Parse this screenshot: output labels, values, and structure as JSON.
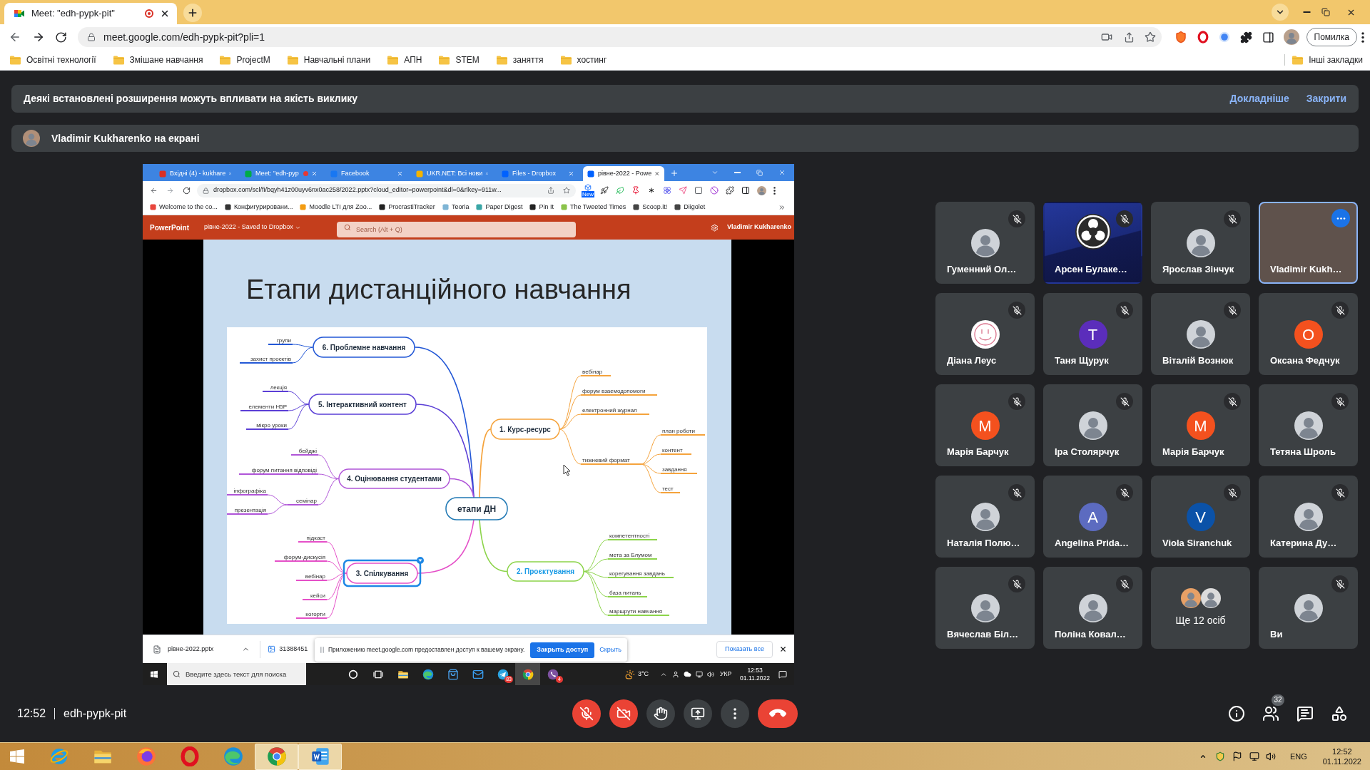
{
  "browser": {
    "tabs": [
      {
        "title": "Meet: \"edh-pypk-pit\"",
        "selected": true,
        "recording": true
      }
    ],
    "url": "meet.google.com/edh-pypk-pit?pli=1",
    "profile_status": "Помилка",
    "bookmarks": [
      "Освітні технології",
      "Змішане навчання",
      "ProjectM",
      "Навчальні плани",
      "АПН",
      "STEM",
      "заняття",
      "хостинг"
    ],
    "other_bookmarks": "Інші закладки"
  },
  "notice": {
    "text": "Деякі встановлені розширення можуть впливати на якість виклику",
    "links": [
      "Докладніше",
      "Закрити"
    ]
  },
  "presenter": {
    "text": "Vladimir Kukharenko на екрані"
  },
  "shared_screen": {
    "tabs": [
      {
        "title": "Вхідні (4) - kukhare",
        "selected": false,
        "recording": false
      },
      {
        "title": "Meet: \"edh-pyp",
        "selected": false,
        "recording": true
      },
      {
        "title": "Facebook",
        "selected": false,
        "recording": false
      },
      {
        "title": "UKR.NET: Всі нови",
        "selected": false,
        "recording": false
      },
      {
        "title": "Files - Dropbox",
        "selected": false,
        "recording": false
      },
      {
        "title": "рівне-2022 - Powe",
        "selected": true,
        "recording": false
      }
    ],
    "url": "dropbox.com/scl/fi/bqyh41z00uyv6nx0ac258/2022.pptx?cloud_editor=powerpoint&dl=0&rlkey=911w...",
    "extension_badge": "New",
    "bookmarks": [
      "Welcome to the co...",
      "Конфигурировани...",
      "Moodle LTI для Zoo...",
      "ProcrastiTracker",
      "Teoria",
      "Paper Digest",
      "Pin It",
      "The Tweeted Times",
      "Scoop.it!",
      "Diigolet"
    ],
    "app": {
      "name": "PowerPoint",
      "document": "рівне-2022 - Saved to Dropbox",
      "search_placeholder": "Search (Alt + Q)",
      "user": "Vladimir Kukharenko"
    },
    "slide": {
      "title": "Етапи дистанційного навчання",
      "mindmap": {
        "center": "етапи ДН",
        "branches": [
          {
            "label": "6. Проблемне навчання",
            "color": "#2358d6",
            "selected": false,
            "highlighted": false,
            "children": [
              {
                "label": "групи"
              },
              {
                "label": "захист проєктів"
              }
            ]
          },
          {
            "label": "5. Інтерактивний контент",
            "color": "#5b3fd6",
            "selected": false,
            "highlighted": false,
            "children": [
              {
                "label": "лекція"
              },
              {
                "label": "елементи H5P"
              },
              {
                "label": "мікро уроки"
              }
            ]
          },
          {
            "label": "1. Курс-ресурс",
            "color": "#f5a33c",
            "selected": false,
            "highlighted": false,
            "children": [
              {
                "label": "вебінар"
              },
              {
                "label": "форум взаємодопомоги"
              },
              {
                "label": "електронний журнал"
              },
              {
                "label": "тижневий формат",
                "children": [
                  {
                    "label": "план роботи"
                  },
                  {
                    "label": "контент"
                  },
                  {
                    "label": "завдання"
                  },
                  {
                    "label": "тест"
                  }
                ]
              }
            ]
          },
          {
            "label": "4. Оцінювання студентами",
            "color": "#b055d8",
            "selected": false,
            "highlighted": false,
            "children": [
              {
                "label": "бейджі"
              },
              {
                "label": "форум питання відповіді"
              },
              {
                "label": "семінар",
                "children": [
                  {
                    "label": "інфографіка"
                  },
                  {
                    "label": "презентація"
                  }
                ]
              }
            ]
          },
          {
            "label": "3. Спілкування",
            "color": "#e550c8",
            "selected": true,
            "highlighted": false,
            "children": [
              {
                "label": "підкаст"
              },
              {
                "label": "форум-дискусія"
              },
              {
                "label": "вебінар"
              },
              {
                "label": "кейси"
              },
              {
                "label": "когорти"
              }
            ]
          },
          {
            "label": "2. Проєктування",
            "color": "#8cd44a",
            "selected": false,
            "highlighted": true,
            "children": [
              {
                "label": "компетентності"
              },
              {
                "label": "мета за Блумом"
              },
              {
                "label": "корегування завдань"
              },
              {
                "label": "база питань"
              },
              {
                "label": "маршрути навчання"
              }
            ]
          }
        ]
      }
    },
    "downloads": [
      "рівне-2022.pptx",
      "31388451"
    ],
    "show_all": "Показать все",
    "share_notice": {
      "text": "Приложению meet.google.com предоставлен доступ к вашему экрану.",
      "stop_button": "Закрыть доступ",
      "hide_link": "Скрыть"
    },
    "taskbar": {
      "search_placeholder": "Введите здесь текст для поиска",
      "apps": [
        {
          "kind": "cortana",
          "active": false
        },
        {
          "kind": "taskview",
          "active": false
        },
        {
          "kind": "explorer",
          "active": false
        },
        {
          "kind": "edge",
          "active": false
        },
        {
          "kind": "store",
          "active": false
        },
        {
          "kind": "mail",
          "active": false
        },
        {
          "kind": "telegram",
          "active": false,
          "badge": "83"
        },
        {
          "kind": "chrome",
          "active": true
        },
        {
          "kind": "viber",
          "active": false,
          "badge": "4"
        }
      ],
      "weather": "3°C",
      "language": "УКР",
      "time": "12:53",
      "date": "01.11.2022"
    }
  },
  "participants": [
    {
      "name": "Гуменний Ол…",
      "kind": "photo",
      "muted": true,
      "highlighted": false
    },
    {
      "name": "Арсен Булаке…",
      "kind": "logo",
      "muted": true,
      "highlighted": false
    },
    {
      "name": "Ярослав Зінчук",
      "kind": "photo",
      "muted": true,
      "highlighted": false
    },
    {
      "name": "Vladimir Kukh…",
      "kind": "video",
      "muted": false,
      "highlighted": true
    },
    {
      "name": "Діана Леус",
      "kind": "drawing",
      "muted": true,
      "highlighted": false
    },
    {
      "name": "Таня Щурук",
      "kind": "initial",
      "initial": "Т",
      "color": "#5b2dbb",
      "muted": true,
      "highlighted": false
    },
    {
      "name": "Віталій Вознюк",
      "kind": "photo",
      "muted": true,
      "highlighted": false
    },
    {
      "name": "Оксана Федчук",
      "kind": "initial",
      "initial": "О",
      "color": "#f4511e",
      "muted": true,
      "highlighted": false
    },
    {
      "name": "Марія Барчук",
      "kind": "initial",
      "initial": "М",
      "color": "#f4511e",
      "muted": true,
      "highlighted": false
    },
    {
      "name": "Іра Столярчук",
      "kind": "photo",
      "muted": true,
      "highlighted": false
    },
    {
      "name": "Марія Барчук",
      "kind": "initial",
      "initial": "М",
      "color": "#f4511e",
      "muted": true,
      "highlighted": false
    },
    {
      "name": "Тетяна Шроль",
      "kind": "photo",
      "muted": true,
      "highlighted": false
    },
    {
      "name": "Наталія Полю…",
      "kind": "photo",
      "muted": true,
      "highlighted": false
    },
    {
      "name": "Angelina Prida…",
      "kind": "initial",
      "initial": "A",
      "color": "#5c6bc0",
      "muted": true,
      "highlighted": false
    },
    {
      "name": "Viola Siranchuk",
      "kind": "initial",
      "initial": "V",
      "color": "#0b52a8",
      "muted": true,
      "highlighted": false
    },
    {
      "name": "Катерина Ду…",
      "kind": "photo",
      "muted": true,
      "highlighted": false
    },
    {
      "name": "Вячеслав Біл…",
      "kind": "photo",
      "muted": true,
      "highlighted": false
    },
    {
      "name": "Поліна Ковал…",
      "kind": "photo",
      "muted": true,
      "highlighted": false
    },
    {
      "name": "Ще 12 осіб",
      "kind": "overflow",
      "muted": false,
      "highlighted": false
    },
    {
      "name": "Ви",
      "kind": "photo",
      "muted": true,
      "highlighted": false
    }
  ],
  "meeting_bar": {
    "time": "12:52",
    "code": "edh-pypk-pit",
    "toggles": [
      {
        "kind": "mic",
        "on": false
      },
      {
        "kind": "camera",
        "on": false
      },
      {
        "kind": "hand",
        "on": false
      },
      {
        "kind": "present",
        "on": false
      }
    ],
    "actions": [
      {
        "kind": "more"
      },
      {
        "kind": "leave"
      }
    ],
    "side_buttons": [
      {
        "kind": "info"
      },
      {
        "kind": "people",
        "badge": "32"
      },
      {
        "kind": "chat"
      },
      {
        "kind": "activities"
      }
    ]
  },
  "taskbar": {
    "apps": [
      {
        "kind": "start",
        "active": false
      },
      {
        "kind": "ie",
        "active": false
      },
      {
        "kind": "explorer",
        "active": false
      },
      {
        "kind": "firefox",
        "active": false
      },
      {
        "kind": "opera",
        "active": false
      },
      {
        "kind": "edge",
        "active": false
      },
      {
        "kind": "chrome",
        "active": true
      },
      {
        "kind": "word",
        "active": true
      }
    ],
    "language": "ENG",
    "time": "12:52",
    "date": "01.11.2022"
  }
}
